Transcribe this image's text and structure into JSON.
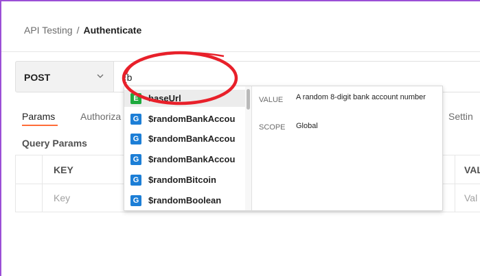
{
  "breadcrumb": {
    "parent": "API Testing",
    "separator": "/",
    "current": "Authenticate"
  },
  "request": {
    "method": "POST",
    "method_chevron_icon": "chevron-down-icon",
    "url_value": "{b"
  },
  "tabs": {
    "params": "Params",
    "authorization": "Authoriza",
    "settings": "Settin"
  },
  "section": {
    "query_params_label": "Query Params"
  },
  "table": {
    "key_header": "KEY",
    "value_header": "VAL",
    "key_placeholder": "Key",
    "value_placeholder": "Val"
  },
  "autocomplete": {
    "items": [
      {
        "badge": "E",
        "label": "baseUrl",
        "kind": "environment"
      },
      {
        "badge": "G",
        "label": "$randomBankAccou",
        "kind": "global"
      },
      {
        "badge": "G",
        "label": "$randomBankAccou",
        "kind": "global"
      },
      {
        "badge": "G",
        "label": "$randomBankAccou",
        "kind": "global"
      },
      {
        "badge": "G",
        "label": "$randomBitcoin",
        "kind": "global"
      },
      {
        "badge": "G",
        "label": "$randomBoolean",
        "kind": "global"
      }
    ],
    "detail": {
      "value_key": "VALUE",
      "value_text": "A random 8-digit bank account number",
      "scope_key": "SCOPE",
      "scope_text": "Global"
    }
  },
  "colors": {
    "accent_tab": "#ff6c37",
    "env_badge": "#1faa3e",
    "global_badge": "#1c7ed6",
    "annotation_circle": "#e8202a",
    "frame_border": "#9b4fd6"
  }
}
